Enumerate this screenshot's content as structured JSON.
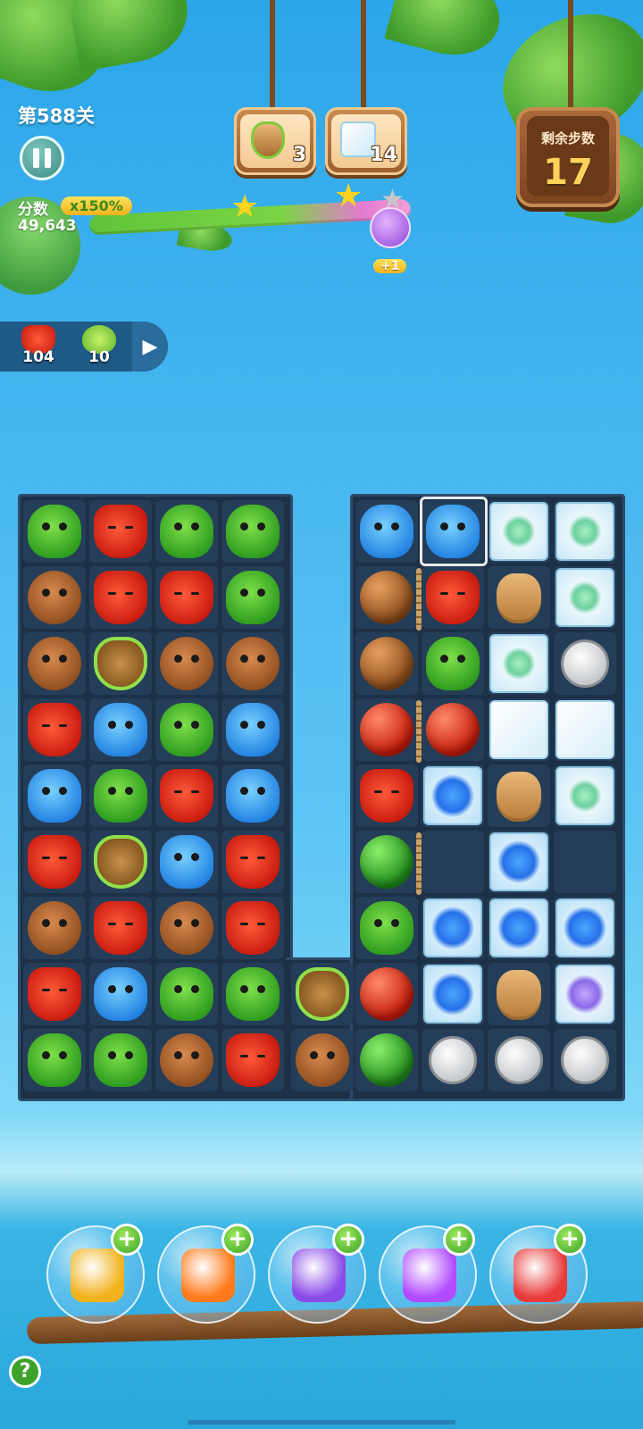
{
  "hud": {
    "level": "第588关",
    "score_label": "分数",
    "multiplier": "x150%",
    "score": "49,643",
    "bonus": "+1",
    "moves_label": "剩余步数",
    "moves": "17"
  },
  "goals": [
    {
      "icon": "leaf-stone-icon",
      "count": "3"
    },
    {
      "icon": "ice-block-icon",
      "count": "14"
    }
  ],
  "collected": [
    {
      "icon": "fox-icon",
      "count": "104"
    },
    {
      "icon": "green-heart-icon",
      "count": "10"
    }
  ],
  "board_left": [
    [
      "frog",
      "fox",
      "frog",
      "frog"
    ],
    [
      "bear",
      "fox",
      "fox",
      "frog"
    ],
    [
      "bear",
      "leaf",
      "bear",
      "bear"
    ],
    [
      "fox",
      "hippo",
      "frog",
      "hippo"
    ],
    [
      "hippo",
      "frog",
      "fox",
      "hippo"
    ],
    [
      "fox",
      "leaf",
      "hippo",
      "fox"
    ],
    [
      "bear",
      "fox",
      "bear",
      "fox"
    ],
    [
      "fox",
      "hippo",
      "frog",
      "frog"
    ],
    [
      "frog",
      "frog",
      "bear",
      "fox"
    ]
  ],
  "board_mid": [
    [
      "empty"
    ],
    [
      "empty"
    ],
    [
      "empty"
    ],
    [
      "empty"
    ],
    [
      "empty"
    ],
    [
      "empty"
    ],
    [
      "empty"
    ],
    [
      "leaf"
    ],
    [
      "bear"
    ]
  ],
  "board_right": [
    [
      "hippo",
      "hippo",
      "iceflower",
      "iceflower"
    ],
    [
      "brownball",
      "fox",
      "stone",
      "iceflower"
    ],
    [
      "brownball",
      "frog",
      "iceflower",
      "coin"
    ],
    [
      "redball",
      "redball",
      "ice",
      "ice"
    ],
    [
      "fox",
      "bluegem",
      "stone",
      "iceflower"
    ],
    [
      "greenball",
      "empty",
      "bluegem",
      "empty"
    ],
    [
      "frog",
      "bluegem",
      "bluegem",
      "bluegem"
    ],
    [
      "redball",
      "bluegem",
      "stone",
      "purpleflower"
    ],
    [
      "greenball",
      "coin",
      "coin",
      "coin"
    ]
  ],
  "boosters": [
    {
      "icon": "shuffle-icon",
      "add": "+"
    },
    {
      "icon": "clock-icon",
      "add": "+"
    },
    {
      "icon": "swap-icon",
      "add": "+"
    },
    {
      "icon": "purple-rocket-icon",
      "add": "+"
    },
    {
      "icon": "red-rocket-icon",
      "add": "+"
    }
  ],
  "help": "?",
  "colors": {
    "board": "#1c3148",
    "cell": "#243d58",
    "accent": "#ffd25a"
  }
}
